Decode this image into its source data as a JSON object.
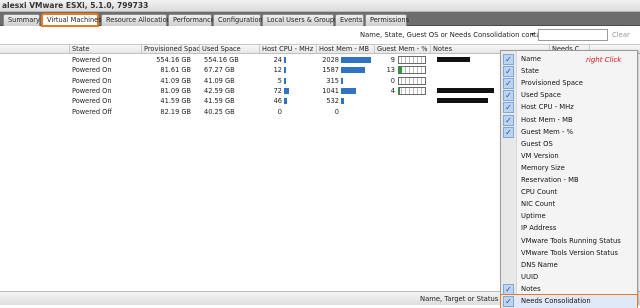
{
  "window": {
    "title": "alesxi VMware ESXi, 5.1.0, 799733"
  },
  "tabs": [
    {
      "label": "Summary"
    },
    {
      "label": "Virtual Machines"
    },
    {
      "label": "Resource Allocation"
    },
    {
      "label": "Performance"
    },
    {
      "label": "Configuration"
    },
    {
      "label": "Local Users & Groups"
    },
    {
      "label": "Events"
    },
    {
      "label": "Permissions"
    }
  ],
  "filter": {
    "label": "Name, State, Guest OS or Needs Consolidation contains:",
    "value": "",
    "clear_label": "Clear"
  },
  "columns": [
    {
      "label": ""
    },
    {
      "label": "State"
    },
    {
      "label": "Provisioned Space"
    },
    {
      "label": "Used Space"
    },
    {
      "label": "Host CPU - MHz"
    },
    {
      "label": "Host Mem - MB"
    },
    {
      "label": "Guest Mem - %"
    },
    {
      "label": "Notes"
    },
    {
      "label": "Needs C"
    }
  ],
  "rows": [
    {
      "state": "Powered On",
      "provisioned": "554.16 GB",
      "used": "554.16 GB",
      "cpu": "24",
      "cpu_level": 0.06,
      "mem": "2028",
      "mem_level": 0.95,
      "guest_mem": "9",
      "guest_level": 0.0,
      "notes_redacted": true,
      "notes_len": 0.55
    },
    {
      "state": "Powered On",
      "provisioned": "81.61 GB",
      "used": "67.27 GB",
      "cpu": "12",
      "cpu_level": 0.03,
      "mem": "1587",
      "mem_level": 0.74,
      "guest_mem": "13",
      "guest_level": 0.13,
      "notes_redacted": false,
      "notes_len": 0
    },
    {
      "state": "Powered On",
      "provisioned": "41.09 GB",
      "used": "41.09 GB",
      "cpu": "5",
      "cpu_level": 0.01,
      "mem": "315",
      "mem_level": 0.05,
      "guest_mem": "0",
      "guest_level": 0.0,
      "notes_redacted": false,
      "notes_len": 0
    },
    {
      "state": "Powered On",
      "provisioned": "81.09 GB",
      "used": "42.59 GB",
      "cpu": "72",
      "cpu_level": 0.18,
      "mem": "1041",
      "mem_level": 0.48,
      "guest_mem": "4",
      "guest_level": 0.04,
      "notes_redacted": true,
      "notes_len": 0.95
    },
    {
      "state": "Powered On",
      "provisioned": "41.59 GB",
      "used": "41.59 GB",
      "cpu": "46",
      "cpu_level": 0.11,
      "mem": "532",
      "mem_level": 0.09,
      "guest_mem": "",
      "guest_level": 0.0,
      "notes_redacted": true,
      "notes_len": 0.85
    },
    {
      "state": "Powered Off",
      "provisioned": "82.19 GB",
      "used": "40.25 GB",
      "cpu": "0",
      "cpu_level": 0.0,
      "mem": "0",
      "mem_level": 0.0,
      "guest_mem": "",
      "guest_level": 0.0,
      "notes_redacted": false,
      "notes_len": 0
    }
  ],
  "column_menu": {
    "annotation": "right Click",
    "items": [
      {
        "label": "Name",
        "checked": true
      },
      {
        "label": "State",
        "checked": true
      },
      {
        "label": "Provisioned Space",
        "checked": true
      },
      {
        "label": "Used Space",
        "checked": true
      },
      {
        "label": "Host CPU - MHz",
        "checked": true
      },
      {
        "label": "Host Mem - MB",
        "checked": true
      },
      {
        "label": "Guest Mem - %",
        "checked": true
      },
      {
        "label": "Guest OS",
        "checked": false
      },
      {
        "label": "VM Version",
        "checked": false
      },
      {
        "label": "Memory Size",
        "checked": false
      },
      {
        "label": "Reservation - MB",
        "checked": false
      },
      {
        "label": "CPU Count",
        "checked": false
      },
      {
        "label": "NIC Count",
        "checked": false
      },
      {
        "label": "Uptime",
        "checked": false
      },
      {
        "label": "IP Address",
        "checked": false
      },
      {
        "label": "VMware Tools Running Status",
        "checked": false
      },
      {
        "label": "VMware Tools Version Status",
        "checked": false
      },
      {
        "label": "DNS Name",
        "checked": false
      },
      {
        "label": "UUID",
        "checked": false
      },
      {
        "label": "Notes",
        "checked": true
      },
      {
        "label": "Needs Consolidation",
        "checked": true,
        "highlighted": true
      }
    ]
  },
  "status": {
    "text": "Name, Target or Status co"
  },
  "colors": {
    "accent": "#e8791f",
    "bar": "#2f73c2",
    "guest_bar": "#22a02a",
    "annotation": "#dd1111"
  }
}
